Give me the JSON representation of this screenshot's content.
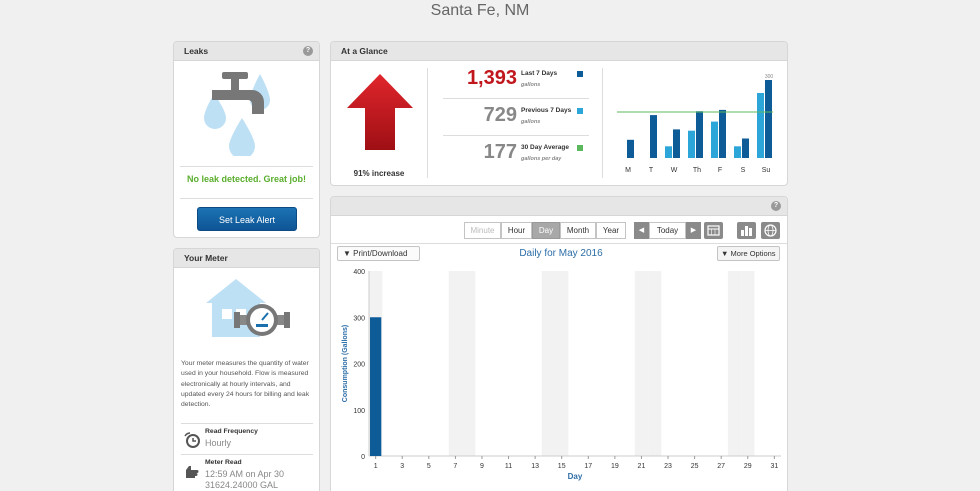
{
  "page": {
    "title": "Santa Fe, NM"
  },
  "leaks": {
    "title": "Leaks",
    "help": "?",
    "message": "No leak detected. Great job!",
    "button": "Set Leak Alert"
  },
  "meter": {
    "title": "Your Meter",
    "description": "Your meter measures the quantity of water used in your household. Flow is measured electronically at hourly intervals, and updated every 24 hours for billing and leak detection.",
    "read_frequency_label": "Read Frequency",
    "read_frequency_value": "Hourly",
    "meter_read_label": "Meter Read",
    "meter_read_time": "12:59 AM on Apr 30",
    "meter_read_value": "31624.24000 GAL"
  },
  "glance": {
    "title": "At a Glance",
    "increase": "91% increase",
    "rows": [
      {
        "value": "1,393",
        "label": "Last 7 Days",
        "sub": "gallons",
        "color": "#c0161c",
        "swatch": "#0d5b97"
      },
      {
        "value": "729",
        "label": "Previous 7 Days",
        "sub": "gallons",
        "color": "#888888",
        "swatch": "#2ca6d8"
      },
      {
        "value": "177",
        "label": "30 Day Average",
        "sub": "gallons per day",
        "color": "#888888",
        "swatch": "#5cb85c"
      }
    ],
    "mini_chart": {
      "days": [
        "M",
        "T",
        "W",
        "Th",
        "F",
        "S",
        "Su"
      ],
      "top_label": "300",
      "prev": [
        0,
        0,
        45,
        105,
        140,
        45,
        250
      ],
      "last": [
        70,
        165,
        110,
        180,
        185,
        75,
        300
      ],
      "avg": 177,
      "max": 300
    }
  },
  "main_chart": {
    "help": "?",
    "views": [
      "Minute",
      "Hour",
      "Day",
      "Month",
      "Year"
    ],
    "active_view": "Day",
    "disabled_view": "Minute",
    "today": "Today",
    "prev_arrow": "◀",
    "next_arrow": "▶",
    "print_label": "Print/Download",
    "more_label": "More Options",
    "caret": "▼"
  },
  "chart_data": {
    "type": "bar",
    "title": "Daily for May 2016",
    "xlabel": "Day",
    "ylabel": "Consumption (Gallons)",
    "ylim": [
      0,
      400
    ],
    "yticks": [
      0,
      100,
      200,
      300,
      400
    ],
    "xticks": [
      1,
      3,
      5,
      7,
      9,
      11,
      13,
      15,
      17,
      19,
      21,
      23,
      25,
      27,
      29,
      31
    ],
    "categories": [
      1,
      2,
      3,
      4,
      5,
      6,
      7,
      8,
      9,
      10,
      11,
      12,
      13,
      14,
      15,
      16,
      17,
      18,
      19,
      20,
      21,
      22,
      23,
      24,
      25,
      26,
      27,
      28,
      29,
      30,
      31
    ],
    "values": [
      300,
      0,
      0,
      0,
      0,
      0,
      0,
      0,
      0,
      0,
      0,
      0,
      0,
      0,
      0,
      0,
      0,
      0,
      0,
      0,
      0,
      0,
      0,
      0,
      0,
      0,
      0,
      0,
      0,
      0,
      0
    ],
    "weekend_days": [
      1,
      7,
      8,
      14,
      15,
      21,
      22,
      28,
      29
    ],
    "colors": {
      "bar": "#0d5b97",
      "weekend": "#f2f2f2",
      "axis_label": "#2d6ea8"
    }
  }
}
